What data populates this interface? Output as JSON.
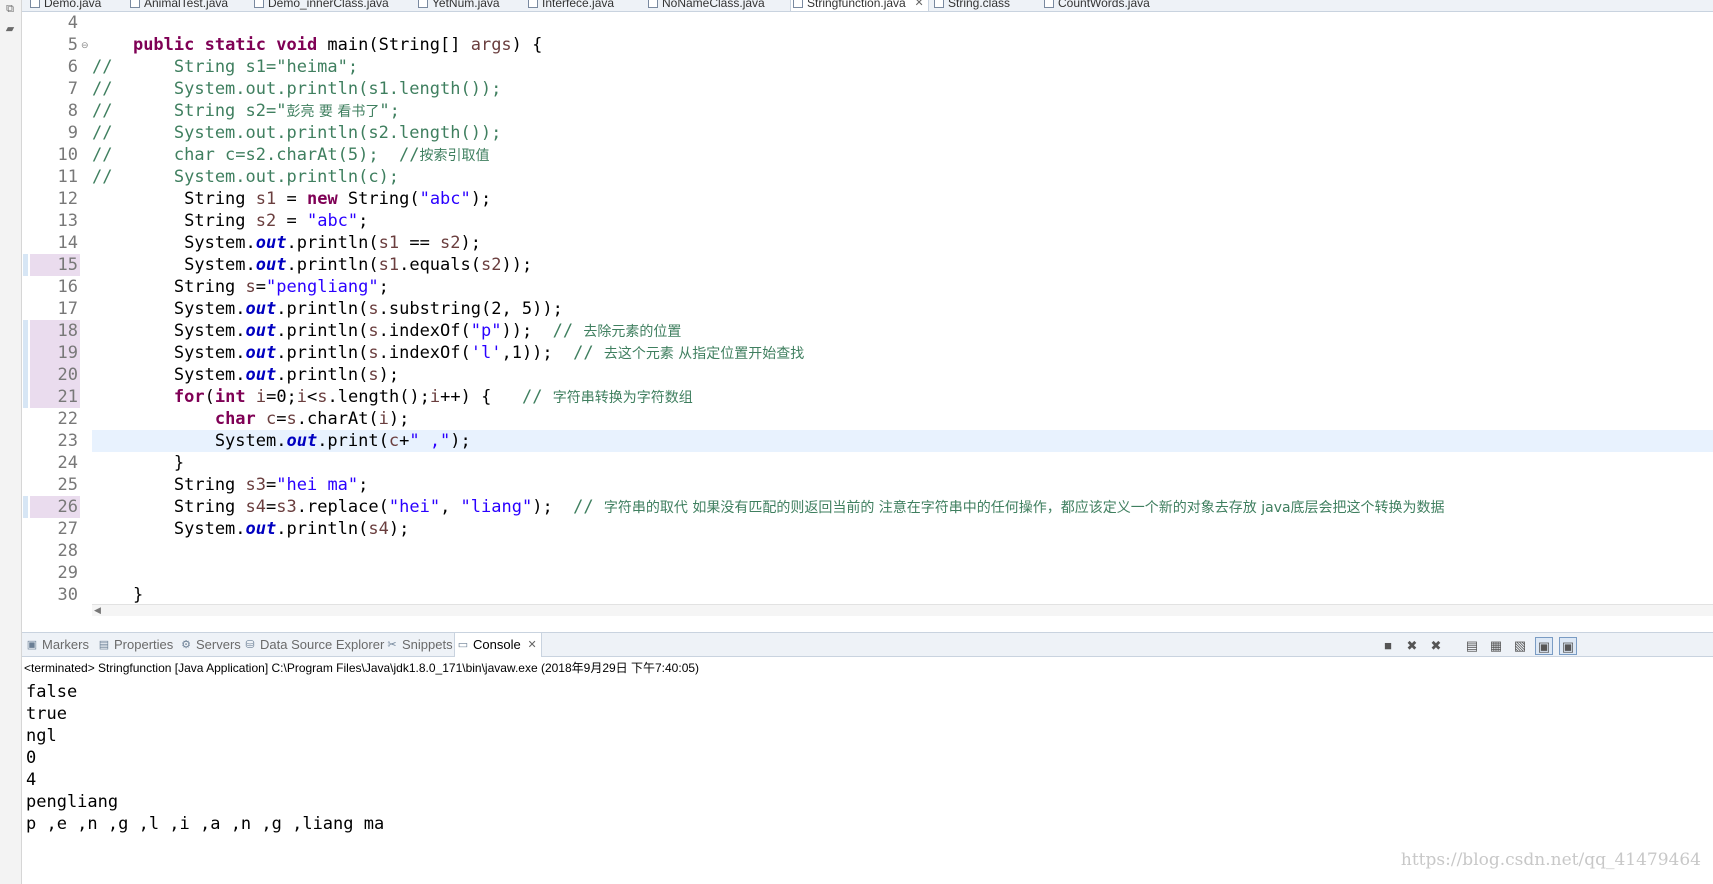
{
  "editor_tabs": [
    {
      "label": "Demo.java",
      "active": false
    },
    {
      "label": "AnimalTest.java",
      "active": false
    },
    {
      "label": "Demo_innerClass.java",
      "active": false
    },
    {
      "label": "YetNum.java",
      "active": false
    },
    {
      "label": "Interfece.java",
      "active": false
    },
    {
      "label": "NoNameClass.java",
      "active": false
    },
    {
      "label": "Stringfunction.java",
      "active": true
    },
    {
      "label": "String.class",
      "active": false
    },
    {
      "label": "CountWords.java",
      "active": false
    }
  ],
  "editor": {
    "line_numbers": [
      "4",
      "5",
      "6",
      "7",
      "8",
      "9",
      "10",
      "11",
      "12",
      "13",
      "14",
      "15",
      "16",
      "17",
      "18",
      "19",
      "20",
      "21",
      "22",
      "23",
      "24",
      "25",
      "26",
      "27",
      "28",
      "29",
      "30"
    ],
    "fold_marker": "⊖",
    "lines": [
      [],
      [
        {
          "t": "    "
        },
        {
          "t": "public static void",
          "c": "kw"
        },
        {
          "t": " main(String[] "
        },
        {
          "t": "args",
          "c": "var"
        },
        {
          "t": ") {"
        }
      ],
      [
        {
          "t": "//      String s1=\"heima\";",
          "c": "com"
        }
      ],
      [
        {
          "t": "//      System.out.println(s1.length());",
          "c": "com"
        }
      ],
      [
        {
          "t": "//      String s2=\"",
          "c": "com"
        },
        {
          "t": "彭亮 要 看书了",
          "c": "com-cn"
        },
        {
          "t": "\";",
          "c": "com"
        }
      ],
      [
        {
          "t": "//      System.out.println(s2.length());",
          "c": "com"
        }
      ],
      [
        {
          "t": "//      char c=s2.charAt(5);  //",
          "c": "com"
        },
        {
          "t": "按索引取值",
          "c": "com-cn"
        }
      ],
      [
        {
          "t": "//      System.out.println(c);",
          "c": "com"
        }
      ],
      [
        {
          "t": "         String "
        },
        {
          "t": "s1",
          "c": "var"
        },
        {
          "t": " = "
        },
        {
          "t": "new",
          "c": "kw"
        },
        {
          "t": " String("
        },
        {
          "t": "\"abc\"",
          "c": "str"
        },
        {
          "t": ");"
        }
      ],
      [
        {
          "t": "         String "
        },
        {
          "t": "s2",
          "c": "var"
        },
        {
          "t": " = "
        },
        {
          "t": "\"abc\"",
          "c": "str"
        },
        {
          "t": ";"
        }
      ],
      [
        {
          "t": "         System."
        },
        {
          "t": "out",
          "c": "fld"
        },
        {
          "t": ".println("
        },
        {
          "t": "s1",
          "c": "var"
        },
        {
          "t": " == "
        },
        {
          "t": "s2",
          "c": "var"
        },
        {
          "t": ");"
        }
      ],
      [
        {
          "t": "         System."
        },
        {
          "t": "out",
          "c": "fld"
        },
        {
          "t": ".println("
        },
        {
          "t": "s1",
          "c": "var"
        },
        {
          "t": ".equals("
        },
        {
          "t": "s2",
          "c": "var"
        },
        {
          "t": "));"
        }
      ],
      [
        {
          "t": "        String "
        },
        {
          "t": "s",
          "c": "var"
        },
        {
          "t": "="
        },
        {
          "t": "\"pengliang\"",
          "c": "str"
        },
        {
          "t": ";"
        }
      ],
      [
        {
          "t": "        System."
        },
        {
          "t": "out",
          "c": "fld"
        },
        {
          "t": ".println("
        },
        {
          "t": "s",
          "c": "var"
        },
        {
          "t": ".substring(2, 5));"
        }
      ],
      [
        {
          "t": "        System."
        },
        {
          "t": "out",
          "c": "fld"
        },
        {
          "t": ".println("
        },
        {
          "t": "s",
          "c": "var"
        },
        {
          "t": ".indexOf("
        },
        {
          "t": "\"p\"",
          "c": "str"
        },
        {
          "t": "));  "
        },
        {
          "t": "// ",
          "c": "com"
        },
        {
          "t": "去除元素的位置",
          "c": "com-cn"
        }
      ],
      [
        {
          "t": "        System."
        },
        {
          "t": "out",
          "c": "fld"
        },
        {
          "t": ".println("
        },
        {
          "t": "s",
          "c": "var"
        },
        {
          "t": ".indexOf("
        },
        {
          "t": "'l'",
          "c": "str"
        },
        {
          "t": ",1));  "
        },
        {
          "t": "// ",
          "c": "com"
        },
        {
          "t": "去这个元素 从指定位置开始查找",
          "c": "com-cn"
        }
      ],
      [
        {
          "t": "        System."
        },
        {
          "t": "out",
          "c": "fld"
        },
        {
          "t": ".println("
        },
        {
          "t": "s",
          "c": "var"
        },
        {
          "t": ");"
        }
      ],
      [
        {
          "t": "        "
        },
        {
          "t": "for",
          "c": "kw"
        },
        {
          "t": "("
        },
        {
          "t": "int",
          "c": "kw"
        },
        {
          "t": " "
        },
        {
          "t": "i",
          "c": "var"
        },
        {
          "t": "=0;"
        },
        {
          "t": "i",
          "c": "var"
        },
        {
          "t": "<"
        },
        {
          "t": "s",
          "c": "var"
        },
        {
          "t": ".length();"
        },
        {
          "t": "i",
          "c": "var"
        },
        {
          "t": "++) {   "
        },
        {
          "t": "// ",
          "c": "com"
        },
        {
          "t": "字符串转换为字符数组",
          "c": "com-cn"
        }
      ],
      [
        {
          "t": "            "
        },
        {
          "t": "char",
          "c": "kw"
        },
        {
          "t": " "
        },
        {
          "t": "c",
          "c": "var"
        },
        {
          "t": "="
        },
        {
          "t": "s",
          "c": "var"
        },
        {
          "t": ".charAt("
        },
        {
          "t": "i",
          "c": "var"
        },
        {
          "t": ");"
        }
      ],
      [
        {
          "t": "            System."
        },
        {
          "t": "out",
          "c": "fld"
        },
        {
          "t": ".print("
        },
        {
          "t": "c",
          "c": "var"
        },
        {
          "t": "+"
        },
        {
          "t": "\" ,\"",
          "c": "str"
        },
        {
          "t": ");"
        }
      ],
      [
        {
          "t": "        }"
        }
      ],
      [
        {
          "t": "        String "
        },
        {
          "t": "s3",
          "c": "var"
        },
        {
          "t": "="
        },
        {
          "t": "\"hei ma\"",
          "c": "str"
        },
        {
          "t": ";"
        }
      ],
      [
        {
          "t": "        String "
        },
        {
          "t": "s4",
          "c": "var"
        },
        {
          "t": "="
        },
        {
          "t": "s3",
          "c": "var"
        },
        {
          "t": ".replace("
        },
        {
          "t": "\"hei\"",
          "c": "str"
        },
        {
          "t": ", "
        },
        {
          "t": "\"liang\"",
          "c": "str"
        },
        {
          "t": ");  "
        },
        {
          "t": "// ",
          "c": "com"
        },
        {
          "t": "字符串的取代 如果没有匹配的则返回当前的 注意在字符串中的任何操作，都应该定义一个新的对象去存放 java底层会把这个转换为数据",
          "c": "com-cn"
        }
      ],
      [
        {
          "t": "        System."
        },
        {
          "t": "out",
          "c": "fld"
        },
        {
          "t": ".println("
        },
        {
          "t": "s4",
          "c": "var"
        },
        {
          "t": ");"
        }
      ],
      [],
      [],
      [
        {
          "t": "    }"
        }
      ]
    ]
  },
  "panel": {
    "tabs": [
      {
        "label": "Markers",
        "icon": "markers-icon",
        "glyph": "▣",
        "active": false
      },
      {
        "label": "Properties",
        "icon": "properties-icon",
        "glyph": "▤",
        "active": false
      },
      {
        "label": "Servers",
        "icon": "servers-icon",
        "glyph": "⚙",
        "active": false
      },
      {
        "label": "Data Source Explorer",
        "icon": "database-icon",
        "glyph": "⛁",
        "active": false
      },
      {
        "label": "Snippets",
        "icon": "snippets-icon",
        "glyph": "✂",
        "active": false
      },
      {
        "label": "Console",
        "icon": "console-icon",
        "glyph": "▭",
        "active": true
      }
    ],
    "console_header": "<terminated> Stringfunction [Java Application] C:\\Program Files\\Java\\jdk1.8.0_171\\bin\\javaw.exe (2018年9月29日 下午7:40:05)",
    "output": [
      "false",
      "true",
      "ngl",
      "0",
      "4",
      "pengliang",
      "p ,e ,n ,g ,l ,i ,a ,n ,g ,liang ma"
    ]
  },
  "watermark": "https://blog.csdn.net/qq_41479464",
  "colors": {
    "keyword": "#7f0055",
    "string": "#2a00ff",
    "comment": "#3f7f5f",
    "field": "#0000c0",
    "current_line": "#e8f2fe"
  }
}
